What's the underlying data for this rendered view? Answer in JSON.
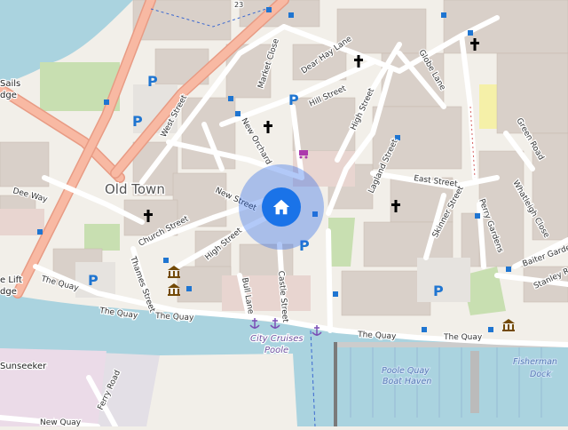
{
  "map": {
    "district": "Old Town",
    "streets": {
      "west_street": "West Street",
      "new_orchard": "New Orchard",
      "market_close": "Market Close",
      "dear_hay_lane": "Dear Hay Lane",
      "hill_street": "Hill Street",
      "high_street": "High Street",
      "high_street_2": "High Street",
      "globe_lane": "Globe Lane",
      "green_road": "Green Road",
      "lagland_street": "Lagland Street",
      "east_street": "East Street",
      "wheatleigh_close": "Whatleigh Close",
      "skinner_street": "Skinner Street",
      "perry_gardens": "Perry Gardens",
      "baiter_gardens": "Baiter Gardens",
      "stanley_road": "Stanley R",
      "dee_way": "Dee Way",
      "church_street": "Church Street",
      "new_street": "New Street",
      "thames_street": "Thames Street",
      "bull_lane": "Bull Lane",
      "castle_street": "Castle Street",
      "the_quay_1": "The Quay",
      "the_quay_2": "The Quay",
      "the_quay_3": "The Quay",
      "the_quay_4": "The Quay",
      "ferry_road": "Ferry Road",
      "new_quay": "New Quay",
      "street_23": "23"
    },
    "places": {
      "sails": "Sails",
      "sails_2": "dge",
      "lift": "e Lift",
      "lift_2": "dge",
      "sunseeker": "Sunseeker",
      "city_cruises": "City Cruises",
      "city_cruises_2": "Poole",
      "poole_quay": "Poole Quay",
      "poole_quay_2": "Boat Haven",
      "fisherman": "Fisherman",
      "fisherman_2": "Dock"
    },
    "parking_symbol": "P",
    "location_marker": "home-icon"
  }
}
